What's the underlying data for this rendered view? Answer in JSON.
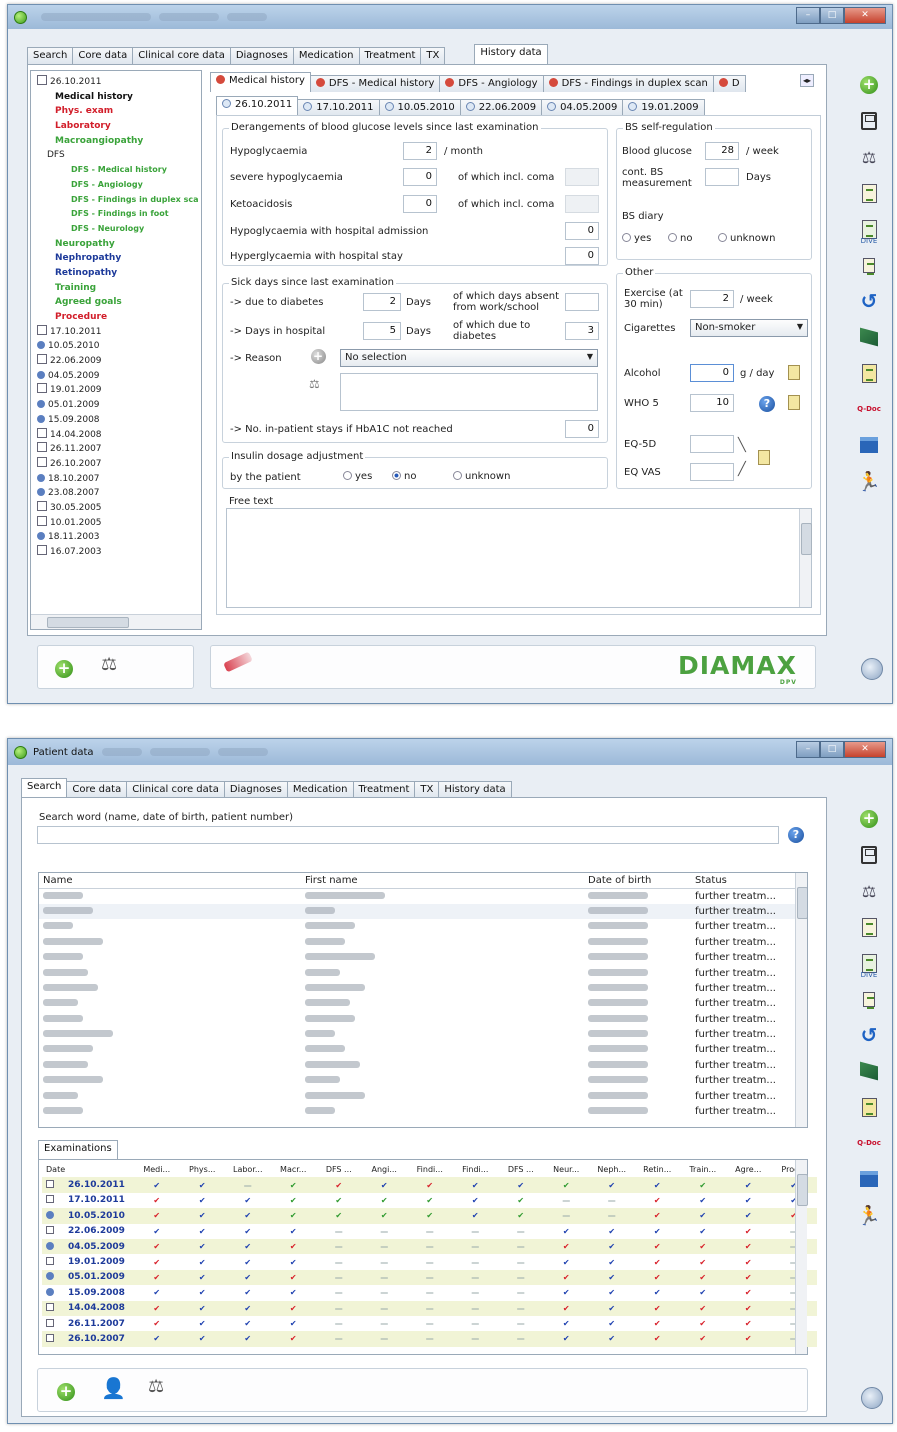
{
  "window1": {
    "main_tabs": [
      "Search",
      "Core data",
      "Clinical core data",
      "Diagnoses",
      "Medication",
      "Treatment",
      "TX",
      "History data"
    ],
    "tree": [
      {
        "text": "26.10.2011",
        "style": "cal"
      },
      {
        "text": "Medical history",
        "style": "bold"
      },
      {
        "text": "Phys. exam",
        "style": "red"
      },
      {
        "text": "Laboratory",
        "style": "red"
      },
      {
        "text": "Macroangiopathy",
        "style": "green"
      },
      {
        "text": "DFS",
        "style": "plain"
      },
      {
        "text": "DFS - Medical history",
        "style": "green"
      },
      {
        "text": "DFS - Angiology",
        "style": "green"
      },
      {
        "text": "DFS - Findings in duplex sca",
        "style": "green"
      },
      {
        "text": "DFS - Findings in foot",
        "style": "green"
      },
      {
        "text": "DFS - Neurology",
        "style": "green"
      },
      {
        "text": "Neuropathy",
        "style": "green"
      },
      {
        "text": "Nephropathy",
        "style": "blue"
      },
      {
        "text": "Retinopathy",
        "style": "blue"
      },
      {
        "text": "Training",
        "style": "green"
      },
      {
        "text": "Agreed goals",
        "style": "green"
      },
      {
        "text": "Procedure",
        "style": "red"
      },
      {
        "text": "17.10.2011",
        "style": "cal"
      },
      {
        "text": "10.05.2010",
        "style": "dot"
      },
      {
        "text": "22.06.2009",
        "style": "cal"
      },
      {
        "text": "04.05.2009",
        "style": "dot"
      },
      {
        "text": "19.01.2009",
        "style": "cal"
      },
      {
        "text": "05.01.2009",
        "style": "dot"
      },
      {
        "text": "15.09.2008",
        "style": "dot"
      },
      {
        "text": "14.04.2008",
        "style": "cal"
      },
      {
        "text": "26.11.2007",
        "style": "cal"
      },
      {
        "text": "26.10.2007",
        "style": "cal"
      },
      {
        "text": "18.10.2007",
        "style": "dot"
      },
      {
        "text": "23.08.2007",
        "style": "dot"
      },
      {
        "text": "30.05.2005",
        "style": "cal"
      },
      {
        "text": "10.01.2005",
        "style": "cal"
      },
      {
        "text": "18.11.2003",
        "style": "dot"
      },
      {
        "text": "16.07.2003",
        "style": "cal"
      }
    ],
    "sub_tabs": [
      "Medical history",
      "DFS - Medical history",
      "DFS - Angiology",
      "DFS - Findings in duplex scan",
      "D"
    ],
    "date_tabs": [
      "26.10.2011",
      "17.10.2011",
      "10.05.2010",
      "22.06.2009",
      "04.05.2009",
      "19.01.2009"
    ],
    "derangements": {
      "title": "Derangements of blood glucose levels since last examination",
      "hypo_label": "Hypoglycaemia",
      "hypo_value": "2",
      "hypo_unit": "/ month",
      "severe_label": "severe hypoglycaemia",
      "severe_value": "0",
      "coma_label1": "of which incl. coma",
      "keto_label": "Ketoacidosis",
      "keto_value": "0",
      "coma_label2": "of which incl. coma",
      "hypo_adm_label": "Hypoglycaemia with hospital admission",
      "hypo_adm_value": "0",
      "hyper_label": "Hyperglycaemia with hospital stay",
      "hyper_value": "0"
    },
    "bs_self": {
      "title": "BS self-regulation",
      "glucose_label": "Blood glucose",
      "glucose_value": "28",
      "glucose_unit": "/ week",
      "cont_label": "cont. BS measurement",
      "cont_unit": "Days",
      "diary_label": "BS diary",
      "yes": "yes",
      "no": "no",
      "unknown": "unknown"
    },
    "sick_days": {
      "title": "Sick days since last examination",
      "due_label": "->  due to diabetes",
      "due_value": "2",
      "days1": "Days",
      "absent_label": "of which days absent from work/school",
      "hosp_label": "->  Days in hospital",
      "hosp_value": "5",
      "days2": "Days",
      "due_diab_label": "of which due to diabetes",
      "due_diab_value": "3",
      "reason_label": "->  Reason",
      "reason_value": "No selection",
      "inpatient_label": "->  No. in-patient stays if HbA1C not reached",
      "inpatient_value": "0"
    },
    "other": {
      "title": "Other",
      "exercise_label": "Exercise (at 30 min)",
      "exercise_value": "2",
      "exercise_unit": "/ week",
      "cig_label": "Cigarettes",
      "cig_value": "Non-smoker",
      "alcohol_label": "Alcohol",
      "alcohol_value": "0",
      "alcohol_unit": "g / day",
      "who_label": "WHO 5",
      "who_value": "10",
      "eq5d_label": "EQ-5D",
      "eqvas_label": "EQ VAS"
    },
    "insulin": {
      "title": "Insulin dosage adjustment",
      "by_label": "by the patient",
      "yes": "yes",
      "no": "no",
      "unknown": "unknown"
    },
    "free_text_label": "Free text",
    "brand": "DIAMAX",
    "brand_sub": "DPV"
  },
  "window2": {
    "title": "Patient data",
    "main_tabs": [
      "Search",
      "Core data",
      "Clinical core data",
      "Diagnoses",
      "Medication",
      "Treatment",
      "TX",
      "History data"
    ],
    "search_label": "Search word (name, date of birth, patient number)",
    "columns": [
      "Name",
      "First name",
      "Date of birth",
      "Status"
    ],
    "status_rows": [
      "further treatm...",
      "further treatm...",
      "further treatm...",
      "further treatm...",
      "further treatm...",
      "further treatm...",
      "further treatm...",
      "further treatm...",
      "further treatm...",
      "further treatm...",
      "further treatm...",
      "further treatm...",
      "further treatm...",
      "further treatm...",
      "further treatm..."
    ],
    "exam_tab": "Examinations",
    "exam_columns": [
      "Date",
      "Medi...",
      "Phys...",
      "Labor...",
      "Macr...",
      "DFS ...",
      "Angi...",
      "Findi...",
      "Findi...",
      "DFS ...",
      "Neur...",
      "Neph...",
      "Retin...",
      "Train...",
      "Agre...",
      "Proc..."
    ],
    "exam_rows": [
      {
        "date": "26.10.2011",
        "icon": "cal",
        "marks": "bb-grbrbbgbbgbb-"
      },
      {
        "date": "17.10.2011",
        "icon": "cal",
        "marks": "rbbggggbg--rbbb"
      },
      {
        "date": "10.05.2010",
        "icon": "dot",
        "marks": "rbbggggbg--rbbr"
      },
      {
        "date": "22.06.2009",
        "icon": "cal",
        "marks": "bbbb-----bbbbr"
      },
      {
        "date": "04.05.2009",
        "icon": "dot",
        "marks": "rbbr-----rbrrr"
      },
      {
        "date": "19.01.2009",
        "icon": "cal",
        "marks": "rbbb-----bbrrr"
      },
      {
        "date": "05.01.2009",
        "icon": "dot",
        "marks": "rbbr-----rbrrr"
      },
      {
        "date": "15.09.2008",
        "icon": "dot",
        "marks": "bbbb-----bbbbr"
      },
      {
        "date": "14.04.2008",
        "icon": "cal",
        "marks": "rbbr-----rbrrr"
      },
      {
        "date": "26.11.2007",
        "icon": "cal",
        "marks": "rbbb-----bbrrr"
      },
      {
        "date": "26.10.2007",
        "icon": "cal",
        "marks": "bbbr-----bbrrr"
      }
    ]
  }
}
